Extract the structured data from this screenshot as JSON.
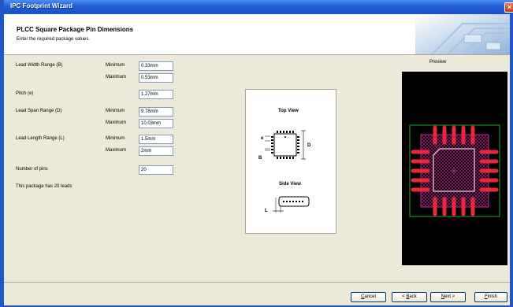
{
  "window": {
    "title": "IPC Footprint Wizard",
    "close_glyph": "×"
  },
  "header": {
    "title": "PLCC Square Package Pin Dimensions",
    "subtitle": "Enter the required package values."
  },
  "form": {
    "lead_width": {
      "label": "Lead Width Range (B)",
      "min_label": "Minimum",
      "min_value": "0.33mm",
      "max_label": "Maximum",
      "max_value": "0.53mm"
    },
    "pitch": {
      "label": "Pitch (e)",
      "value": "1.27mm"
    },
    "lead_span": {
      "label": "Lead Span Range (D)",
      "min_label": "Minimum",
      "min_value": "9.78mm",
      "max_label": "Maximum",
      "max_value": "10.03mm"
    },
    "lead_length": {
      "label": "Lead Length Range (L)",
      "min_label": "Minimum",
      "min_value": "1.5mm",
      "max_label": "Maximum",
      "max_value": "2mm"
    },
    "pins": {
      "label": "Number of pins",
      "value": "20"
    },
    "info": "This package has 20 leads"
  },
  "diagram": {
    "top_view": "Top View",
    "side_view": "Side View",
    "e": "e",
    "b": "B",
    "d": "D",
    "l": "L"
  },
  "preview": {
    "title": "Preview"
  },
  "buttons": {
    "cancel_key": "C",
    "cancel_rest": "ancel",
    "back_prefix": "< ",
    "back_key": "B",
    "back_rest": "ack",
    "next_key": "N",
    "next_rest": "ext >",
    "finish_key": "F",
    "finish_rest": "inish"
  },
  "colors": {
    "title_bar": "#1f5fd6",
    "pad": "#e8283c",
    "body_outline": "#c02090",
    "courtyard": "#22aa33",
    "silkscreen": "#ffffff"
  }
}
